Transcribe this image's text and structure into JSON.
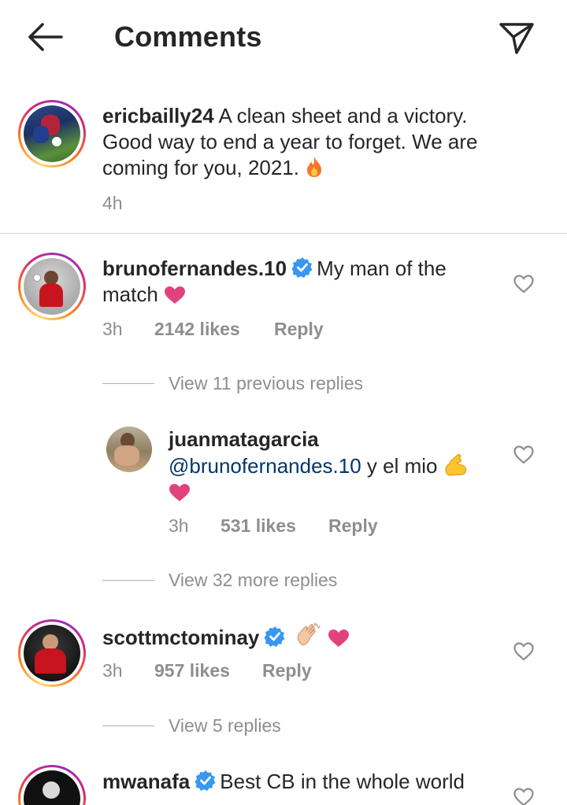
{
  "header": {
    "title": "Comments",
    "back_icon": "arrow-left-icon",
    "send_icon": "paper-plane-icon"
  },
  "caption": {
    "username": "ericbailly24",
    "text": "A clean sheet and a victory. Good way to end a year to forget. We are coming for you, 2021.",
    "emoji": "fire-icon",
    "time": "4h"
  },
  "comments": [
    {
      "username": "brunofernandes.10",
      "verified": true,
      "text": "My man of the match",
      "emoji": "pink-heart-icon",
      "time": "3h",
      "likes": "2142 likes",
      "reply": "Reply",
      "view_replies": "View 11 previous replies",
      "replies": [
        {
          "username": "juanmatagarcia",
          "mention": "@brunofernandes.10",
          "text": "y el mio",
          "emoji": "flexed-biceps-icon",
          "emoji2": "pink-heart-icon",
          "time": "3h",
          "likes": "531 likes",
          "reply": "Reply"
        }
      ],
      "more_replies": "View 32 more replies"
    },
    {
      "username": "scottmctominay",
      "verified": true,
      "text": "",
      "emoji": "clapping-hands-icon",
      "emoji2": "pink-heart-icon",
      "time": "3h",
      "likes": "957 likes",
      "reply": "Reply",
      "view_replies": "View 5 replies"
    },
    {
      "username": "mwanafa",
      "verified": true,
      "text": "Best CB in the whole world"
    }
  ],
  "colors": {
    "verified": "#3897f0",
    "heart": "#e0437c",
    "muted": "#8e8e8e",
    "mention": "#00376b"
  }
}
